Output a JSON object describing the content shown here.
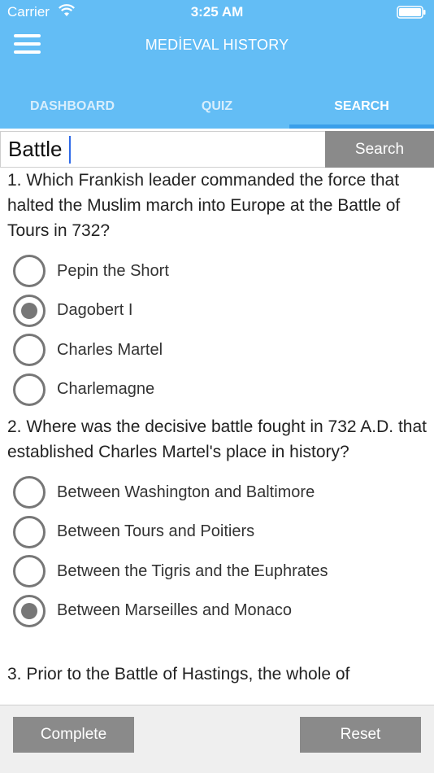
{
  "status_bar": {
    "carrier": "Carrier",
    "time": "3:25 AM"
  },
  "app": {
    "title": "MEDİEVAL HISTORY"
  },
  "tabs": [
    {
      "label": "DASHBOARD",
      "active": false
    },
    {
      "label": "QUIZ",
      "active": false
    },
    {
      "label": "SEARCH",
      "active": true
    }
  ],
  "search": {
    "value": "Battle",
    "button_label": "Search"
  },
  "questions": [
    {
      "text": "1. Which Frankish leader commanded the force that halted the Muslim march into Europe at the Battle of Tours in 732?",
      "options": [
        "Pepin the Short",
        "Dagobert I",
        "Charles Martel",
        "Charlemagne"
      ],
      "selected_index": 1
    },
    {
      "text": "2. Where was the decisive battle fought in 732 A.D. that established Charles Martel's place in history?",
      "options": [
        "Between Washington and Baltimore",
        "Between Tours and Poitiers",
        "Between the Tigris and the Euphrates",
        "Between Marseilles and Monaco"
      ],
      "selected_index": 3
    },
    {
      "text": "3. Prior to the Battle of Hastings, the whole of",
      "options": [],
      "selected_index": -1
    }
  ],
  "footer": {
    "complete_label": "Complete",
    "reset_label": "Reset"
  },
  "colors": {
    "header": "#63bdf5",
    "tab_indicator": "#3a9fea",
    "button": "#8a8a8a",
    "caret": "#2e6ae8"
  }
}
